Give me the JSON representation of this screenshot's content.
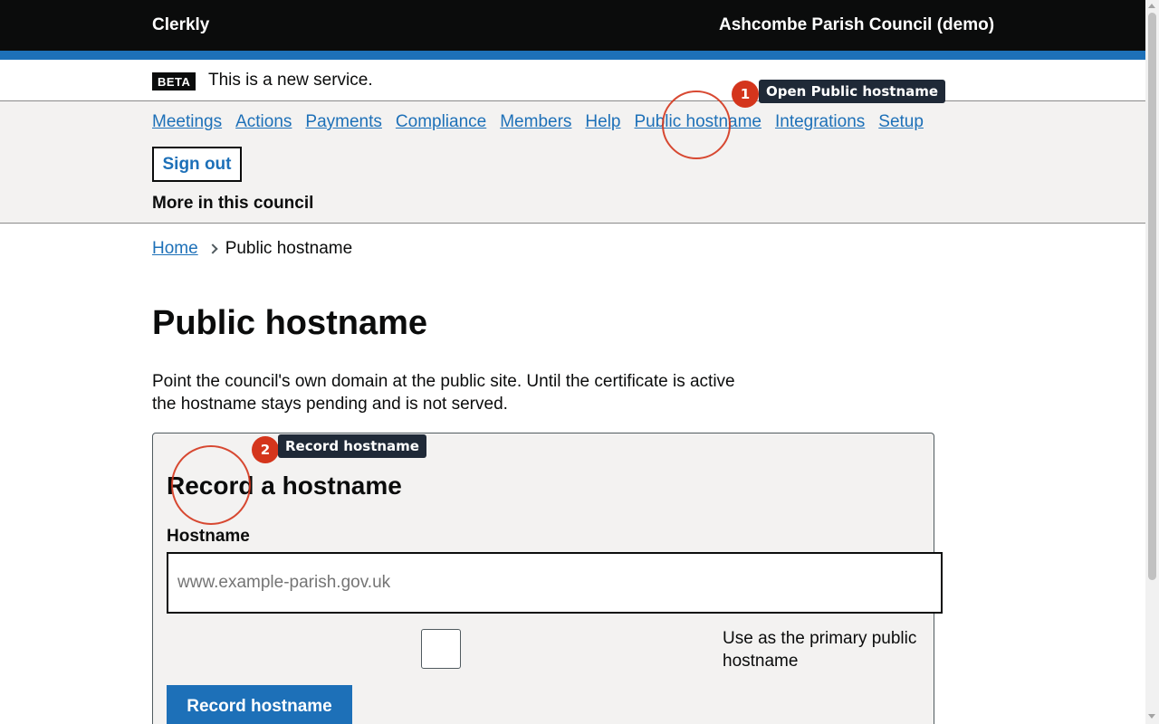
{
  "header": {
    "brand": "Clerkly",
    "council": "Ashcombe Parish Council (demo)"
  },
  "phase_banner": {
    "tag": "BETA",
    "message": "This is a new service."
  },
  "nav": {
    "links": [
      "Meetings",
      "Actions",
      "Payments",
      "Compliance",
      "Members",
      "Help",
      "Public hostname",
      "Integrations",
      "Setup"
    ],
    "sign_out": "Sign out",
    "more": "More in this council"
  },
  "breadcrumb": {
    "home": "Home",
    "current": "Public hostname"
  },
  "page": {
    "title": "Public hostname",
    "lede": "Point the council's own domain at the public site. Until the certificate is active the hostname stays pending and is not served."
  },
  "form": {
    "heading": "Record a hostname",
    "hostname_label": "Hostname",
    "hostname_value": "",
    "hostname_placeholder": "www.example-parish.gov.uk",
    "primary_checkbox_label": "Use as the primary public hostname",
    "primary_checkbox_checked": false,
    "submit": "Record hostname"
  },
  "annotations": [
    {
      "number": "1",
      "label": "Open Public hostname"
    },
    {
      "number": "2",
      "label": "Record hostname"
    }
  ],
  "colors": {
    "link": "#1d70b8",
    "header": "#0b0c0c",
    "accent_bar": "#1d70b8",
    "panel": "#f3f2f1",
    "annotation": "#d4351c",
    "annotation_label": "#1f2937"
  }
}
